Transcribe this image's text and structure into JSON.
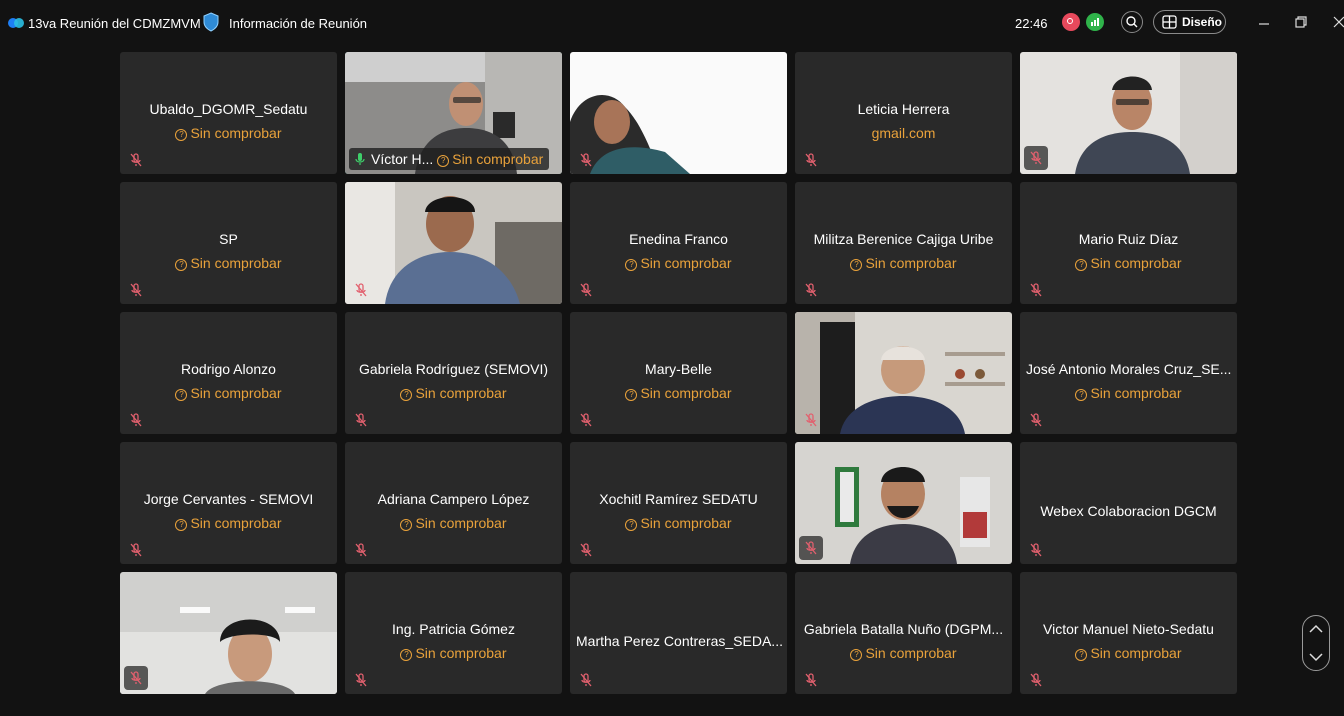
{
  "titlebar": {
    "meeting_title": "13va Reunión del CDMZMVM",
    "info_label": "Información de Reunión",
    "clock": "22:46",
    "layout_label": "Diseño",
    "icons": [
      "webex-logo-icon",
      "shield-icon",
      "recording-icon",
      "network-icon",
      "zoom-icon",
      "layout-grid-icon",
      "minimize-icon",
      "maximize-icon",
      "close-icon"
    ]
  },
  "colors": {
    "background": "#121212",
    "tile": "#292929",
    "status": "#e9a23b",
    "active_border": "#3fb0a0"
  },
  "participants": [
    {
      "name": "Ubaldo_DGOMR_Sedatu",
      "status": "Sin comprobar",
      "video": false
    },
    {
      "name": "Víctor H...",
      "status": "Sin comprobar",
      "video": true,
      "active": true
    },
    {
      "name": "",
      "status": "",
      "video": true
    },
    {
      "name": "Leticia Herrera",
      "status": "gmail.com",
      "video": false
    },
    {
      "name": "",
      "status": "",
      "video": true
    },
    {
      "name": "SP",
      "status": "Sin comprobar",
      "video": false
    },
    {
      "name": "",
      "status": "",
      "video": true
    },
    {
      "name": "Enedina Franco",
      "status": "Sin comprobar",
      "video": false
    },
    {
      "name": "Militza Berenice Cajiga Uribe",
      "status": "Sin comprobar",
      "video": false
    },
    {
      "name": "Mario Ruiz Díaz",
      "status": "Sin comprobar",
      "video": false
    },
    {
      "name": "Rodrigo Alonzo",
      "status": "Sin comprobar",
      "video": false
    },
    {
      "name": "Gabriela Rodríguez (SEMOVI)",
      "status": "Sin comprobar",
      "video": false
    },
    {
      "name": "Mary-Belle",
      "status": "Sin comprobar",
      "video": false
    },
    {
      "name": "",
      "status": "",
      "video": true
    },
    {
      "name": "José Antonio Morales Cruz_SE...",
      "status": "Sin comprobar",
      "video": false
    },
    {
      "name": "Jorge Cervantes - SEMOVI",
      "status": "Sin comprobar",
      "video": false
    },
    {
      "name": "Adriana Campero López",
      "status": "Sin comprobar",
      "video": false
    },
    {
      "name": "Xochitl Ramírez SEDATU",
      "status": "Sin comprobar",
      "video": false
    },
    {
      "name": "",
      "status": "",
      "video": true
    },
    {
      "name": "Webex Colaboracion DGCM",
      "status": "",
      "video": false
    },
    {
      "name": "",
      "status": "",
      "video": true
    },
    {
      "name": "Ing. Patricia Gómez",
      "status": "Sin comprobar",
      "video": false
    },
    {
      "name": "Martha Perez Contreras_SEDA...",
      "status": "",
      "video": false
    },
    {
      "name": "Gabriela Batalla Nuño (DGPM...",
      "status": "Sin comprobar",
      "video": false
    },
    {
      "name": "Victor Manuel Nieto-Sedatu",
      "status": "Sin comprobar",
      "video": false
    }
  ]
}
